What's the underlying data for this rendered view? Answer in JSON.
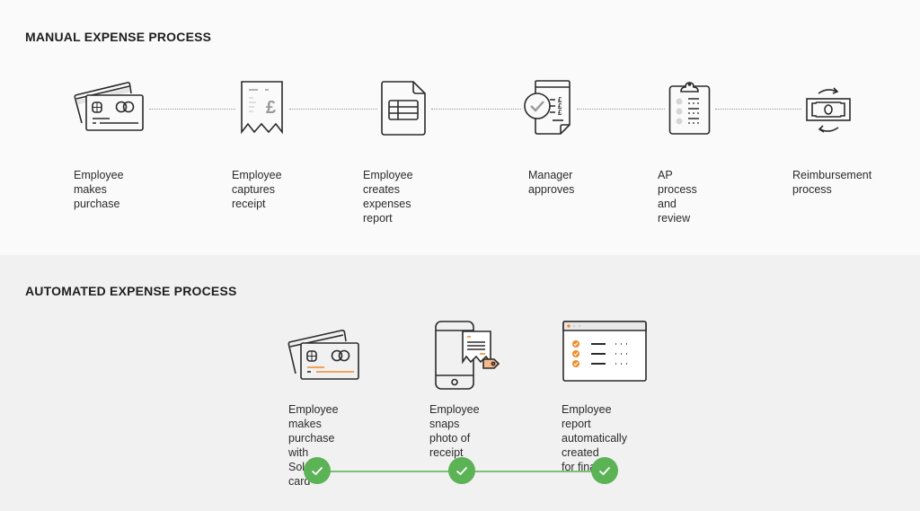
{
  "manual": {
    "title": "MANUAL EXPENSE PROCESS",
    "steps": [
      {
        "label": "Employee\nmakes purchase",
        "icon": "credit-cards-icon"
      },
      {
        "label": "Employee\ncaptures receipt",
        "icon": "receipt-pound-icon"
      },
      {
        "label": "Employee creates\nexpenses report",
        "icon": "spreadsheet-document-icon"
      },
      {
        "label": "Manager\napproves",
        "icon": "approved-invoice-icon"
      },
      {
        "label": "AP process\nand review",
        "icon": "clipboard-checklist-icon"
      },
      {
        "label": "Reimbursement\nprocess",
        "icon": "banknote-exchange-icon"
      }
    ]
  },
  "automated": {
    "title": "AUTOMATED EXPENSE PROCESS",
    "steps": [
      {
        "label": "Employee\nmakes purchase\nwith Soldo card",
        "icon": "soldo-card-icon",
        "status": "complete"
      },
      {
        "label": "Employee snaps\nphoto of receipt",
        "icon": "phone-receipt-icon",
        "status": "complete"
      },
      {
        "label": "Employee report\nautomatically created\nfor finance",
        "icon": "auto-report-window-icon",
        "status": "complete"
      }
    ]
  },
  "colors": {
    "accent_orange": "#f08a2c",
    "success_green": "#5cb356",
    "icon_stroke": "#2b2b2b",
    "manual_bg": "#fafafa",
    "auto_bg": "#f1f1f1"
  }
}
